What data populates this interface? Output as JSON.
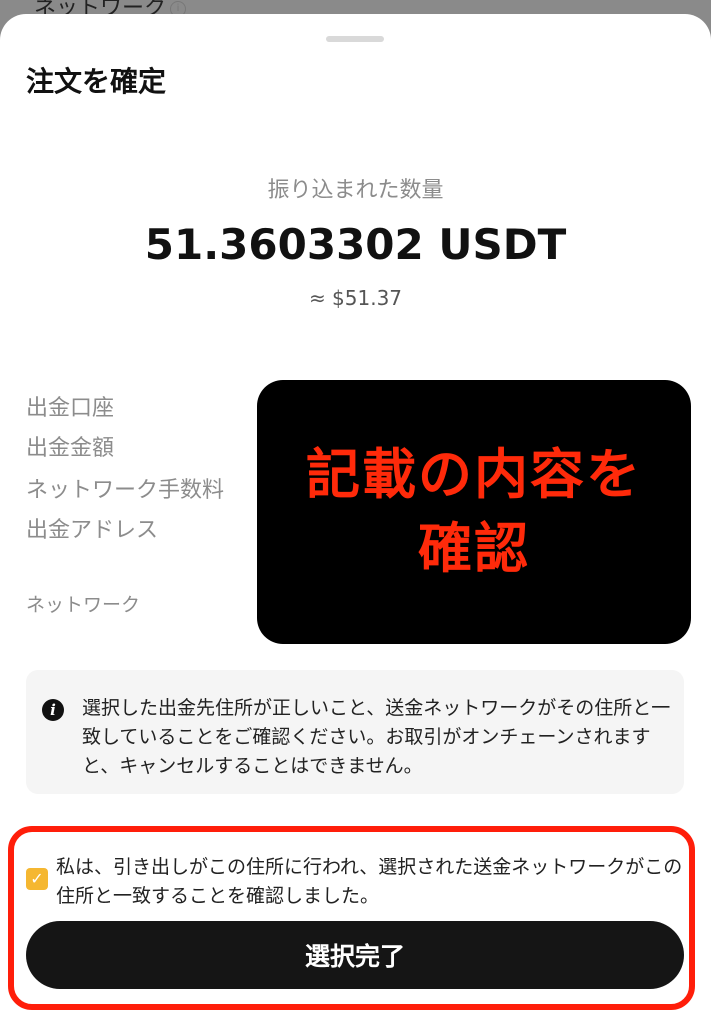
{
  "background": {
    "peek_label": "ネットワーク",
    "peek_icon": "info-outline-icon"
  },
  "sheet": {
    "title": "注文を確定",
    "amount_label": "振り込まれた数量",
    "amount_value": "51.3603302 USDT",
    "amount_fiat": "≈ $51.37"
  },
  "details": {
    "labels": [
      "出金口座",
      "出金金額",
      "ネットワーク手数料",
      "出金アドレス"
    ],
    "network_label": "ネットワーク"
  },
  "overlay": {
    "line1": "記載の内容を",
    "line2": "確認",
    "text_color": "#ff2a0a"
  },
  "notice": {
    "icon": "info-icon",
    "text": "選択した出金先住所が正しいこと、送金ネットワークがその住所と一致していることをご確認ください。お取引がオンチェーンされますと、キャンセルすることはできません。"
  },
  "consent": {
    "checked": true,
    "checkbox_color": "#f5b731",
    "text": "私は、引き出しがこの住所に行われ、選択された送金ネットワークがこの住所と一致することを確認しました。"
  },
  "submit": {
    "label": "選択完了"
  },
  "colors": {
    "highlight_border": "#ff1e0a",
    "button_bg": "#151515"
  }
}
